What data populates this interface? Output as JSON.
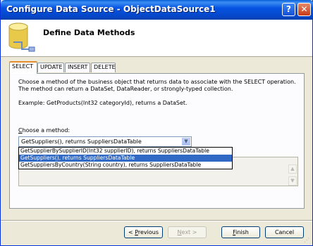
{
  "window": {
    "title": "Configure Data Source - ObjectDataSource1",
    "help_glyph": "?",
    "close_glyph": "✕"
  },
  "header": {
    "title": "Define Data Methods",
    "icon": "database-icon"
  },
  "tabs": [
    {
      "label": "SELECT",
      "active": true
    },
    {
      "label": "UPDATE",
      "active": false
    },
    {
      "label": "INSERT",
      "active": false
    },
    {
      "label": "DELETE",
      "active": false
    }
  ],
  "panel": {
    "description": "Choose a method of the business object that returns data to associate with the SELECT operation. The method can return a DataSet, DataReader, or strongly-typed collection.",
    "example": "Example: GetProducts(Int32 categoryId), returns a DataSet.",
    "choose_label": "Choose a method:",
    "selected_method": "GetSuppliers(), returns SuppliersDataTable",
    "options": [
      "GetSupplierBySupplierID(Int32 supplierID), returns SuppliersDataTable",
      "GetSuppliers(), returns SuppliersDataTable",
      "GetSuppliersByCountry(String country), returns SuppliersDataTable"
    ],
    "highlighted_option_index": 1
  },
  "buttons": {
    "previous": "< Previous",
    "next": "Next >",
    "finish": "Finish",
    "cancel": "Cancel"
  },
  "colors": {
    "title_bar": "#0754e3",
    "selection": "#316ac5",
    "dialog_bg": "#ece9d8",
    "active_tab_accent": "#e68b2c"
  }
}
